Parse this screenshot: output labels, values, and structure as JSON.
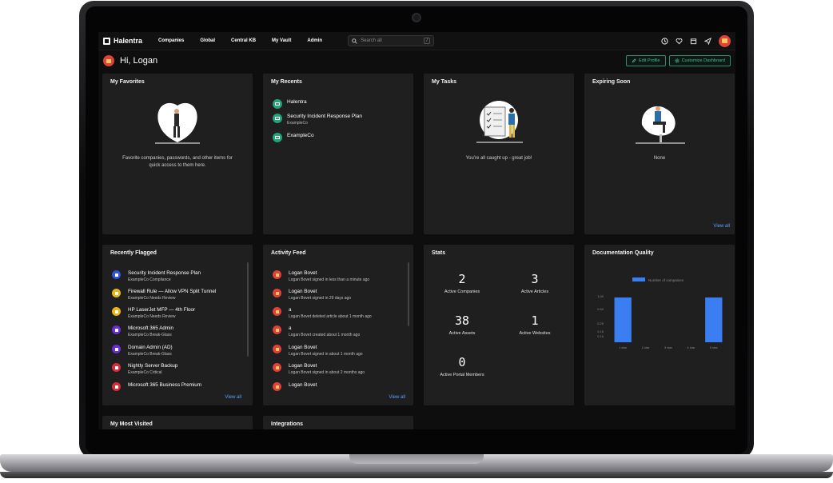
{
  "topnav": {
    "brand": "Halentra",
    "links": [
      "Companies",
      "Global",
      "Central KB",
      "My Vault",
      "Admin"
    ],
    "search_placeholder": "Search all",
    "search_shortcut": "/"
  },
  "header": {
    "greeting": "Hi, Logan",
    "edit_profile": "Edit Profile",
    "customize": "Customize Dashboard"
  },
  "favorites": {
    "title": "My Favorites",
    "empty_line1": "Favorite companies, passwords, and other items for",
    "empty_line2": "quick access to them here."
  },
  "recents": {
    "title": "My Recents",
    "items": [
      {
        "title": "Halentra",
        "sub": ""
      },
      {
        "title": "Security Incident Response Plan",
        "sub": "ExampleCo"
      },
      {
        "title": "ExampleCo",
        "sub": ""
      }
    ]
  },
  "tasks": {
    "title": "My Tasks",
    "empty": "You're all caught up - great job!"
  },
  "expiring": {
    "title": "Expiring Soon",
    "empty": "None",
    "view_all": "View all"
  },
  "flagged": {
    "title": "Recently Flagged",
    "view_all": "View all",
    "items": [
      {
        "title": "Security Incident Response Plan",
        "sub": "ExampleCo Compliance",
        "color": "#2f55d4"
      },
      {
        "title": "Firewall Rule — Allow VPN Split Tunnel",
        "sub": "ExampleCo Needs Review",
        "color": "#e8b516"
      },
      {
        "title": "HP LaserJet MFP — 4th Floor",
        "sub": "ExampleCo Needs Review",
        "color": "#e8b516"
      },
      {
        "title": "Microsoft 365 Admin",
        "sub": "ExampleCo Break-Glass",
        "color": "#6a2fd4"
      },
      {
        "title": "Domain Admin (AD)",
        "sub": "ExampleCo Break-Glass",
        "color": "#6a2fd4"
      },
      {
        "title": "Nightly Server Backup",
        "sub": "ExampleCo Critical",
        "color": "#d42f3a"
      },
      {
        "title": "Microsoft 365 Business Premium",
        "sub": "",
        "color": "#d42f3a"
      }
    ]
  },
  "activity": {
    "title": "Activity Feed",
    "view_all": "View all",
    "items": [
      {
        "title": "Logan Bovet",
        "sub": "Logan Bovet signed in less than a minute ago"
      },
      {
        "title": "Logan Bovet",
        "sub": "Logan Bovet signed in 29 days ago"
      },
      {
        "title": "a",
        "sub": "Logan Bovet deleted article about 1 month ago"
      },
      {
        "title": "a",
        "sub": "Logan Bovet created about 1 month ago"
      },
      {
        "title": "Logan Bovet",
        "sub": "Logan Bovet signed in about 1 month ago"
      },
      {
        "title": "Logan Bovet",
        "sub": "Logan Bovet signed in about 2 months ago"
      },
      {
        "title": "Logan Bovet",
        "sub": ""
      }
    ]
  },
  "stats": {
    "title": "Stats",
    "items": [
      {
        "value": "2",
        "label": "Active Companies"
      },
      {
        "value": "3",
        "label": "Active Articles"
      },
      {
        "value": "38",
        "label": "Active Assets"
      },
      {
        "value": "1",
        "label": "Active Websites"
      },
      {
        "value": "0",
        "label": "Active Portal Members"
      }
    ]
  },
  "docquality": {
    "title": "Documentation Quality"
  },
  "chart_data": {
    "type": "bar",
    "categories": [
      "1 star",
      "2 star",
      "3 star",
      "4 star",
      "5 star"
    ],
    "series": [
      {
        "name": "Number of companies",
        "values": [
          1,
          0,
          0,
          0,
          1
        ]
      }
    ],
    "yticks": [
      "1.00",
      "0.60",
      "0.20",
      "0.15",
      "0.10"
    ],
    "ylim": [
      0,
      1
    ],
    "bar_color": "#3b7ef2",
    "legend": "top"
  },
  "bottom": {
    "visited_title": "My Most Visited",
    "integrations_title": "Integrations"
  },
  "colors": {
    "accent_green": "#39c48e",
    "link_blue": "#5aa0ff",
    "card_bg": "#1f1f1f",
    "avatar_red": "#e0413a"
  }
}
